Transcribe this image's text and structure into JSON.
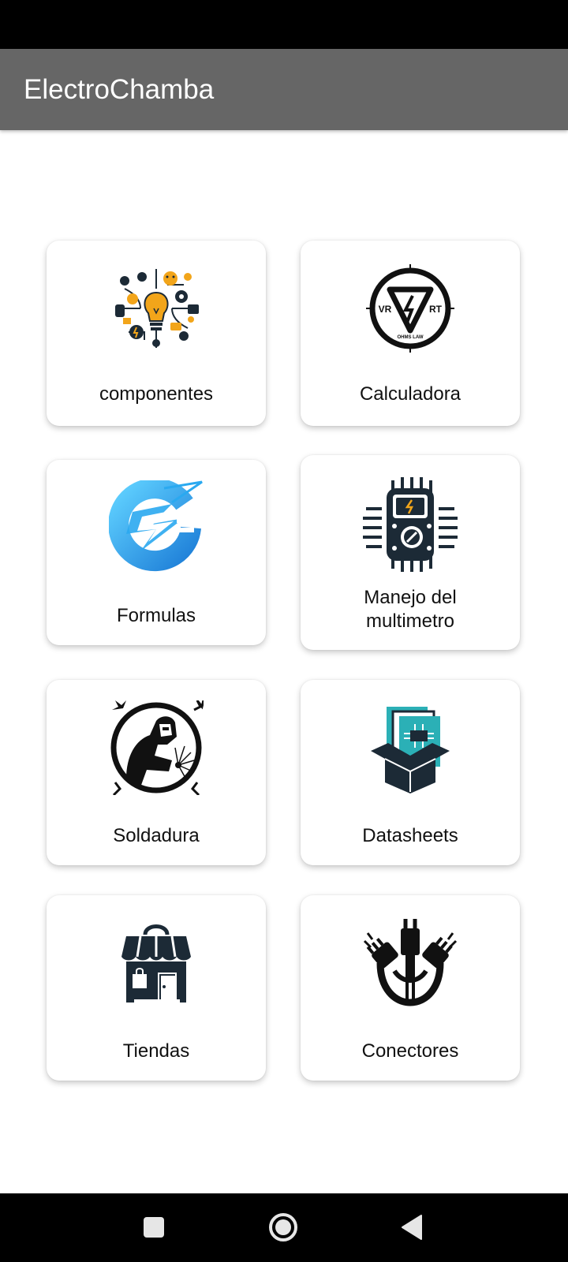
{
  "app": {
    "title": "ElectroChamba"
  },
  "menu": {
    "items": [
      {
        "label": "componentes",
        "icon": "components-collage-icon"
      },
      {
        "label": "Calculadora",
        "icon": "ohms-law-icon",
        "icon_text": [
          "VR",
          "RT",
          "OHMS LAW"
        ]
      },
      {
        "label": "Formulas",
        "icon": "lightning-formula-icon"
      },
      {
        "label": "Manejo del multimetro",
        "icon": "multimeter-icon"
      },
      {
        "label": "Soldadura",
        "icon": "welder-icon"
      },
      {
        "label": "Datasheets",
        "icon": "datasheet-box-icon"
      },
      {
        "label": "Tiendas",
        "icon": "store-icon"
      },
      {
        "label": "Conectores",
        "icon": "connectors-icon"
      }
    ]
  },
  "navigation": {
    "buttons": [
      "recents-square-icon",
      "home-circle-icon",
      "back-triangle-icon"
    ]
  },
  "colors": {
    "app_bar": "#666666",
    "status_bar": "#000000",
    "card_background": "#ffffff",
    "icon_dark": "#1c2a36",
    "icon_accent_blue": "#2aa9f0",
    "icon_accent_orange": "#f2a51a",
    "icon_accent_teal": "#2bb0b6"
  }
}
